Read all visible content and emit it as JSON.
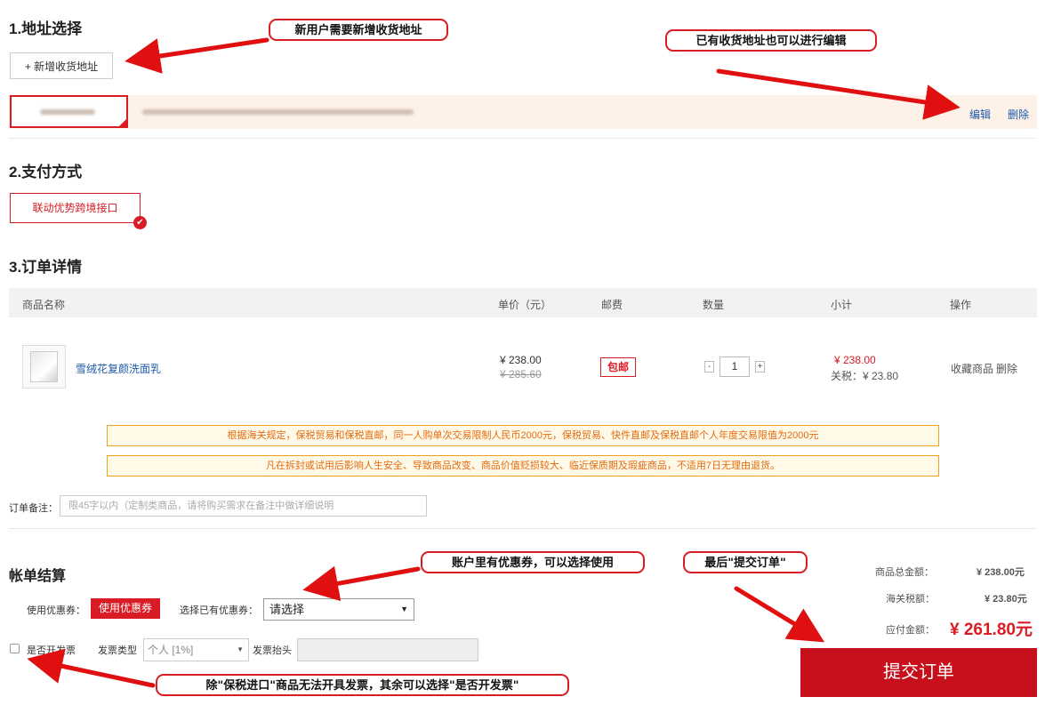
{
  "address": {
    "title": "1.地址选择",
    "add_button": "+ 新增收货地址",
    "edit_link": "编辑",
    "delete_link": "删除"
  },
  "payment": {
    "title": "2.支付方式",
    "option": "联动优势跨境接口"
  },
  "order": {
    "title": "3.订单详情",
    "columns": [
      "商品名称",
      "单价（元）",
      "邮费",
      "数量",
      "小计",
      "操作"
    ],
    "item": {
      "name": "雪绒花复颜洗面乳",
      "price": "¥ 238.00",
      "original_price": "¥ 285.60",
      "shipping": "包邮",
      "quantity": "1",
      "qty_minus": "-",
      "qty_plus": "+",
      "subtotal": "¥ 238.00",
      "tax": "关税：¥ 23.80",
      "favorite": "收藏商品",
      "remove": "删除"
    },
    "notices": [
      "根据海关规定，保税贸易和保税直邮，同一人购单次交易限制人民币2000元，保税贸易、快件直邮及保税直邮个人年度交易限值为2000元",
      "凡在拆封或试用后影响人生安全、导致商品改变、商品价值贬损较大、临近保质期及瑕疵商品，不适用7日无理由退货。"
    ],
    "remark_label": "订单备注：",
    "remark_placeholder": "限45字以内（定制类商品，请将购买需求在备注中做详细说明"
  },
  "bill": {
    "title": "帐单结算",
    "coupon_label": "使用优惠券：",
    "coupon_button": "使用优惠券",
    "existing_coupon_label": "选择已有优惠券：",
    "coupon_select": "请选择",
    "invoice_checkbox_label": "是否开发票",
    "invoice_type_label": "发票类型",
    "invoice_type_value": "个人 [1%]",
    "invoice_title_label": "发票抬头",
    "goods_total_label": "商品总金额：",
    "goods_total": "¥ 238.00元",
    "tax_label": "海关税额：",
    "tax_total": "¥ 23.80元",
    "payable_label": "应付金额：",
    "payable": "¥ 261.80元",
    "submit": "提交订单"
  },
  "annotations": {
    "new_user": "新用户需要新增收货地址",
    "edit_existing": "已有收货地址也可以进行编辑",
    "coupon_note": "账户里有优惠券，可以选择使用",
    "submit_note": "最后\"提交订单\"",
    "invoice_note": "除\"保税进口\"商品无法开具发票，其余可以选择\"是否开发票\""
  },
  "colors": {
    "accent_red": "#d91b24",
    "submit_red": "#c8101c",
    "notice_orange": "#e36b10",
    "link_blue": "#1e5aa8"
  }
}
